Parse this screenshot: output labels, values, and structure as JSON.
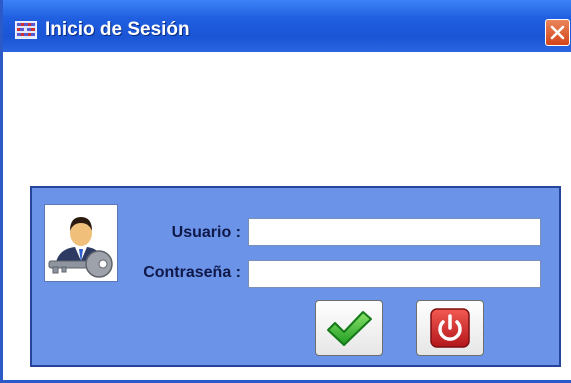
{
  "window": {
    "title": "Inicio de Sesión"
  },
  "icons": {
    "app": "app-grid-icon",
    "close": "close-icon",
    "user": "user-key-icon",
    "accept": "checkmark-icon",
    "exit": "power-icon"
  },
  "form": {
    "user_label": "Usuario :",
    "user_value": "",
    "password_label": "Contraseña :",
    "password_value": ""
  },
  "colors": {
    "titlebar": "#1a55d6",
    "panel": "#6b94e8",
    "close": "#d4441a",
    "accept": "#2ea82e",
    "exit": "#d01e1e"
  }
}
